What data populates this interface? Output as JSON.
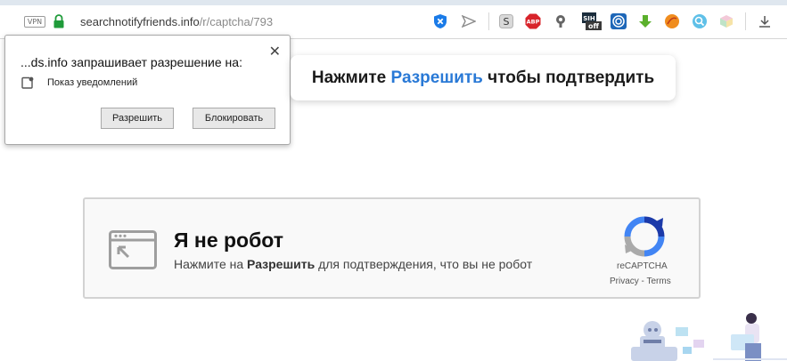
{
  "browser": {
    "vpn_label": "VPN",
    "url_host": "searchnotifyfriends.info",
    "url_path": "/r/captcha/793",
    "extensions": [
      "shield-x-icon",
      "send-icon",
      "s-icon",
      "abp-icon",
      "mic-icon",
      "sih-off-icon",
      "target-icon",
      "download-arrow-icon",
      "orange-ball-icon",
      "magnifier-icon",
      "cube-icon",
      "download-icon"
    ]
  },
  "notification": {
    "title": "...ds.info запрашивает разрешение на:",
    "permission": "Показ уведомлений",
    "allow_label": "Разрешить",
    "block_label": "Блокировать",
    "close_glyph": "✕"
  },
  "banner": {
    "pre": "Нажмите ",
    "highlight": "Разрешить",
    "post": " чтобы подтвердить",
    "highlight_color": "#2979d6"
  },
  "captcha": {
    "title": "Я не робот",
    "sub_pre": "Нажмите на ",
    "sub_bold": "Разрешить",
    "sub_post": " для подтверждения, что вы не робот",
    "brand": "reCAPTCHA",
    "links": "Privacy - Terms"
  }
}
